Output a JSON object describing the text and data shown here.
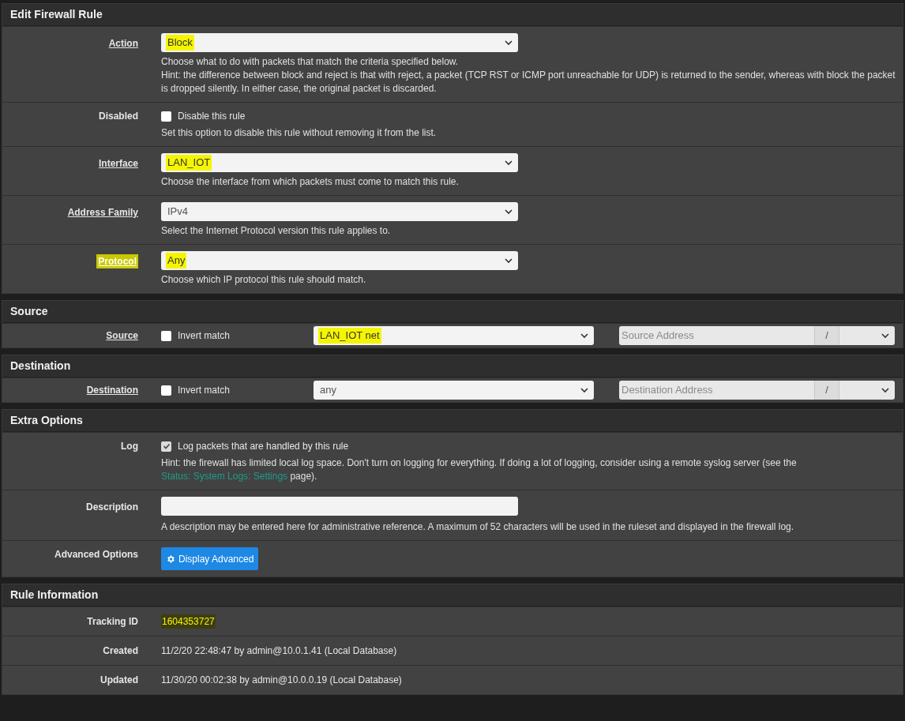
{
  "sections": [
    {
      "title": "Edit Firewall Rule",
      "rows": [
        {
          "kind": "select",
          "label": "Action",
          "label_link": true,
          "label_highlighted": false,
          "value": "Block",
          "highlighted": true,
          "help": [
            "Choose what to do with packets that match the criteria specified below.",
            "Hint: the difference between block and reject is that with reject, a packet (TCP RST or ICMP port unreachable for UDP) is returned to the sender, whereas with block the packet is dropped silently. In either case, the original packet is discarded."
          ]
        },
        {
          "kind": "checkbox",
          "label": "Disabled",
          "label_link": false,
          "label_highlighted": false,
          "checked": false,
          "option": "Disable this rule",
          "help": [
            "Set this option to disable this rule without removing it from the list."
          ]
        },
        {
          "kind": "select",
          "label": "Interface",
          "label_link": true,
          "label_highlighted": false,
          "value": "LAN_IOT",
          "highlighted": true,
          "help": [
            "Choose the interface from which packets must come to match this rule."
          ]
        },
        {
          "kind": "select",
          "label": "Address Family",
          "label_link": true,
          "label_highlighted": false,
          "value": "IPv4",
          "highlighted": false,
          "help": [
            "Select the Internet Protocol version this rule applies to."
          ]
        },
        {
          "kind": "select",
          "label": "Protocol",
          "label_link": true,
          "label_highlighted": true,
          "value": "Any",
          "highlighted": true,
          "help": [
            "Choose which IP protocol this rule should match."
          ]
        }
      ]
    },
    {
      "title": "Source",
      "rows": [
        {
          "kind": "address",
          "label": "Source",
          "label_link": true,
          "label_highlighted": false,
          "checked": false,
          "option": "Invert match",
          "value": "LAN_IOT net",
          "highlighted": true,
          "placeholder": "Source Address",
          "separator": "/"
        }
      ]
    },
    {
      "title": "Destination",
      "rows": [
        {
          "kind": "address",
          "label": "Destination",
          "label_link": true,
          "label_highlighted": false,
          "checked": false,
          "option": "Invert match",
          "value": "any",
          "highlighted": false,
          "placeholder": "Destination Address",
          "separator": "/"
        }
      ]
    },
    {
      "title": "Extra Options",
      "rows": [
        {
          "kind": "checkbox",
          "label": "Log",
          "label_link": false,
          "label_highlighted": false,
          "checked": true,
          "option": "Log packets that are handled by this rule",
          "help": [
            {
              "before": "Hint: the firewall has limited local log space. Don't turn on logging for everything. If doing a lot of logging, consider using a remote syslog server (see the ",
              "link": "Status: System Logs: Settings",
              "after": " page)."
            }
          ]
        },
        {
          "kind": "input",
          "label": "Description",
          "label_link": false,
          "label_highlighted": false,
          "help": [
            "A description may be entered here for administrative reference. A maximum of 52 characters will be used in the ruleset and displayed in the firewall log."
          ]
        },
        {
          "kind": "button",
          "label": "Advanced Options",
          "label_link": false,
          "label_highlighted": false,
          "button": "Display Advanced"
        }
      ]
    },
    {
      "title": "Rule Information",
      "rows": [
        {
          "kind": "info",
          "label": "Tracking ID",
          "label_link": false,
          "label_highlighted": false,
          "value": "1604353727",
          "highlighted": true
        },
        {
          "kind": "info",
          "label": "Created",
          "label_link": false,
          "label_highlighted": false,
          "value": "11/2/20 22:48:47 by admin@10.0.1.41 (Local Database)",
          "highlighted": false
        },
        {
          "kind": "info",
          "label": "Updated",
          "label_link": false,
          "label_highlighted": false,
          "value": "11/30/20 00:02:38 by admin@10.0.0.19 (Local Database)",
          "highlighted": false
        }
      ]
    }
  ]
}
